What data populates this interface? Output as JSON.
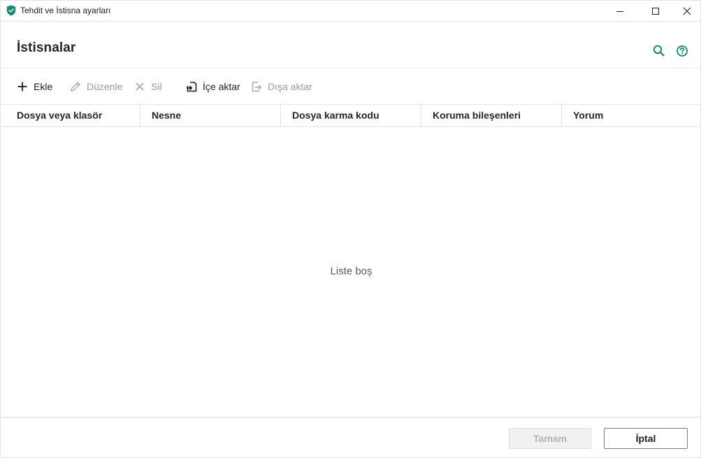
{
  "window": {
    "title": "Tehdit ve İstisna ayarları",
    "accent_color": "#0f8c6f"
  },
  "header": {
    "title": "İstisnalar",
    "icons": [
      "search-icon",
      "help-icon"
    ]
  },
  "toolbar": {
    "add_label": "Ekle",
    "edit_label": "Düzenle",
    "delete_label": "Sil",
    "import_label": "İçe aktar",
    "export_label": "Dışa aktar"
  },
  "table": {
    "columns": [
      "Dosya veya klasör",
      "Nesne",
      "Dosya karma kodu",
      "Koruma bileşenleri",
      "Yorum"
    ],
    "empty_message": "Liste boş"
  },
  "footer": {
    "ok_label": "Tamam",
    "cancel_label": "İptal"
  }
}
